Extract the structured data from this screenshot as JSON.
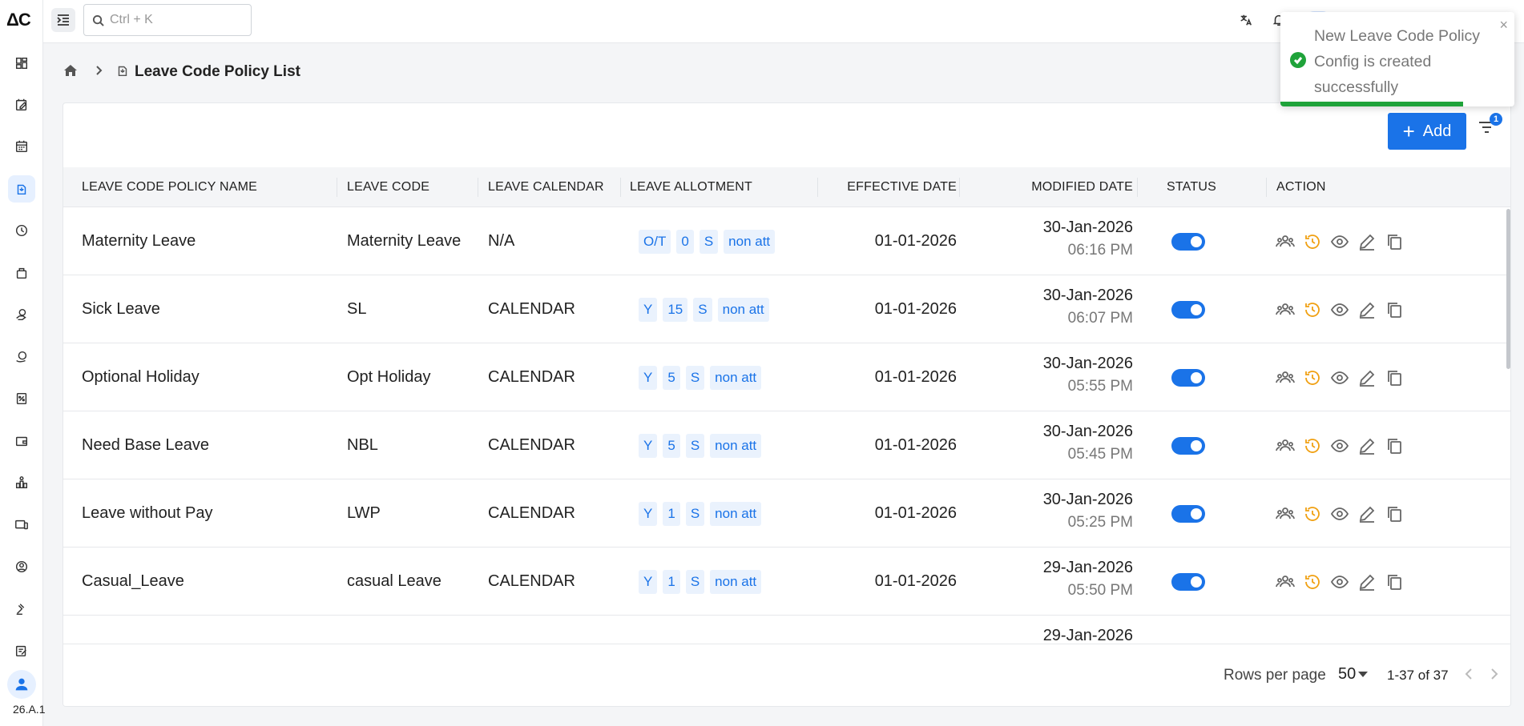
{
  "app": {
    "logo": "ΔC",
    "version": "26.A.1"
  },
  "search": {
    "placeholder": "Ctrl + K"
  },
  "breadcrumb": {
    "title": "Leave Code Policy List"
  },
  "toolbar": {
    "add_label": "Add",
    "filter_count": "1"
  },
  "toast": {
    "message": "New Leave Code Policy Config is created successfully",
    "close": "×",
    "progress": 0.78
  },
  "table": {
    "columns": [
      "LEAVE CODE POLICY NAME",
      "LEAVE CODE",
      "LEAVE CALENDAR",
      "LEAVE ALLOTMENT",
      "EFFECTIVE DATE",
      "MODIFIED DATE",
      "STATUS",
      "ACTION"
    ],
    "rows": [
      {
        "name": "Maternity Leave",
        "code": "Maternity Leave",
        "calendar": "N/A",
        "allot": [
          "O/T",
          "0",
          "S",
          "non att"
        ],
        "effective": "01-01-2026",
        "mod_date": "30-Jan-2026",
        "mod_time": "06:16 PM",
        "active": true
      },
      {
        "name": "Sick Leave",
        "code": "SL",
        "calendar": "CALENDAR",
        "allot": [
          "Y",
          "15",
          "S",
          "non att"
        ],
        "effective": "01-01-2026",
        "mod_date": "30-Jan-2026",
        "mod_time": "06:07 PM",
        "active": true
      },
      {
        "name": "Optional Holiday",
        "code": "Opt Holiday",
        "calendar": "CALENDAR",
        "allot": [
          "Y",
          "5",
          "S",
          "non att"
        ],
        "effective": "01-01-2026",
        "mod_date": "30-Jan-2026",
        "mod_time": "05:55 PM",
        "active": true
      },
      {
        "name": "Need Base Leave",
        "code": "NBL",
        "calendar": "CALENDAR",
        "allot": [
          "Y",
          "5",
          "S",
          "non att"
        ],
        "effective": "01-01-2026",
        "mod_date": "30-Jan-2026",
        "mod_time": "05:45 PM",
        "active": true
      },
      {
        "name": "Leave without Pay",
        "code": "LWP",
        "calendar": "CALENDAR",
        "allot": [
          "Y",
          "1",
          "S",
          "non att"
        ],
        "effective": "01-01-2026",
        "mod_date": "30-Jan-2026",
        "mod_time": "05:25 PM",
        "active": true
      },
      {
        "name": "Casual_Leave",
        "code": "casual Leave",
        "calendar": "CALENDAR",
        "allot": [
          "Y",
          "1",
          "S",
          "non att"
        ],
        "effective": "01-01-2026",
        "mod_date": "29-Jan-2026",
        "mod_time": "05:50 PM",
        "active": true
      },
      {
        "name": "",
        "code": "",
        "calendar": "",
        "allot": [],
        "effective": "",
        "mod_date": "29-Jan-2026",
        "mod_time": "",
        "active": false
      }
    ]
  },
  "pagination": {
    "rows_label": "Rows per page",
    "rows_value": "50",
    "range": "1-37 of 37"
  },
  "colors": {
    "primary": "#1a73e8",
    "success": "#1fa33a",
    "history": "#f0a012"
  }
}
